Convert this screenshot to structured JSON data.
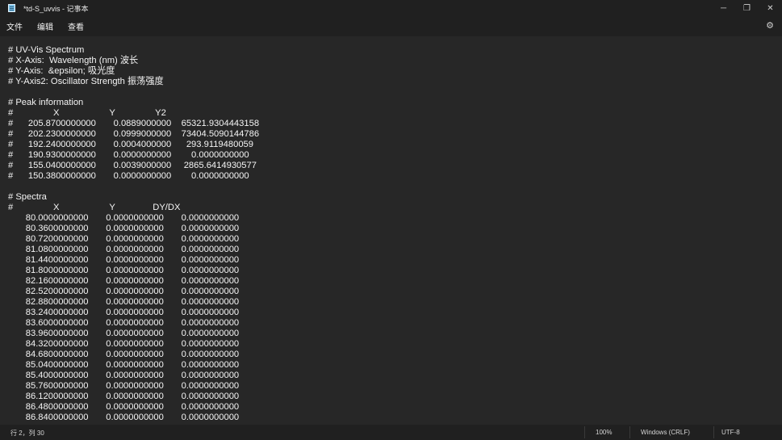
{
  "window": {
    "title": "*td-S_uvvis - 记事本",
    "minimize": "─",
    "maximize": "❐",
    "close": "✕"
  },
  "menu": {
    "file": "文件",
    "edit": "编辑",
    "view": "查看",
    "settings_icon": "⚙"
  },
  "editor": {
    "lines": [
      "# UV-Vis Spectrum",
      "# X-Axis:  Wavelength (nm) 波长",
      "# Y-Axis:  &epsilon; 吸光度",
      "# Y-Axis2: Oscillator Strength 振荡强度",
      "",
      "# Peak information",
      "#                X                    Y                Y2",
      "#      205.8700000000       0.0889000000    65321.9304443158",
      "#      202.2300000000       0.0999000000    73404.5090144786",
      "#      192.2400000000       0.0004000000      293.9119480059",
      "#      190.9300000000       0.0000000000        0.0000000000",
      "#      155.0400000000       0.0039000000     2865.6414930577",
      "#      150.3800000000       0.0000000000        0.0000000000",
      "",
      "# Spectra",
      "#                X                    Y               DY/DX",
      "       80.0000000000       0.0000000000       0.0000000000",
      "       80.3600000000       0.0000000000       0.0000000000",
      "       80.7200000000       0.0000000000       0.0000000000",
      "       81.0800000000       0.0000000000       0.0000000000",
      "       81.4400000000       0.0000000000       0.0000000000",
      "       81.8000000000       0.0000000000       0.0000000000",
      "       82.1600000000       0.0000000000       0.0000000000",
      "       82.5200000000       0.0000000000       0.0000000000",
      "       82.8800000000       0.0000000000       0.0000000000",
      "       83.2400000000       0.0000000000       0.0000000000",
      "       83.6000000000       0.0000000000       0.0000000000",
      "       83.9600000000       0.0000000000       0.0000000000",
      "       84.3200000000       0.0000000000       0.0000000000",
      "       84.6800000000       0.0000000000       0.0000000000",
      "       85.0400000000       0.0000000000       0.0000000000",
      "       85.4000000000       0.0000000000       0.0000000000",
      "       85.7600000000       0.0000000000       0.0000000000",
      "       86.1200000000       0.0000000000       0.0000000000",
      "       86.4800000000       0.0000000000       0.0000000000",
      "       86.8400000000       0.0000000000       0.0000000000"
    ]
  },
  "status": {
    "position": "行 2，列 30",
    "zoom": "100%",
    "line_ending": "Windows (CRLF)",
    "encoding": "UTF-8"
  }
}
